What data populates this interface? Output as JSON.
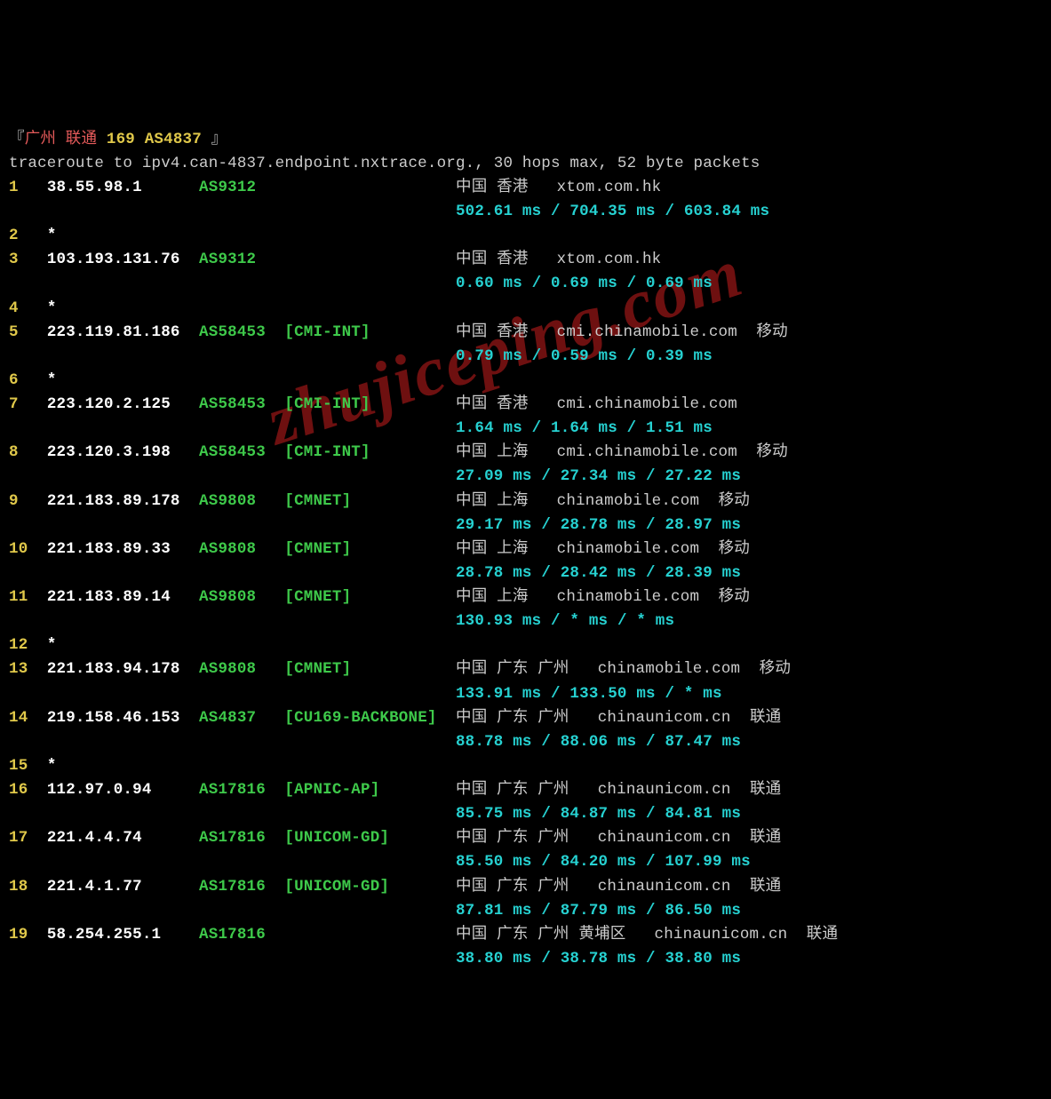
{
  "header": {
    "open": "『",
    "close": "』",
    "location": "广州 联通",
    "asn_text": "169 AS4837"
  },
  "command": "traceroute to ipv4.can-4837.endpoint.nxtrace.org., 30 hops max, 52 byte packets",
  "watermark": "zhujiceping.com",
  "columns": {
    "hop_w": 4,
    "ip_w": 16,
    "asn_w": 9,
    "tag_w": 18,
    "rtt_indent": 47
  },
  "hops": [
    {
      "n": "1",
      "ip": "38.55.98.1",
      "asn": "AS9312",
      "tag": "",
      "loc": "中国 香港",
      "dom": "xtom.com.hk",
      "isp": "",
      "rtt": [
        "502.61 ms",
        "704.35 ms",
        "603.84 ms"
      ]
    },
    {
      "n": "2",
      "ip": "*"
    },
    {
      "n": "3",
      "ip": "103.193.131.76",
      "asn": "AS9312",
      "tag": "",
      "loc": "中国 香港",
      "dom": "xtom.com.hk",
      "isp": "",
      "rtt": [
        "0.60 ms",
        "0.69 ms",
        "0.69 ms"
      ]
    },
    {
      "n": "4",
      "ip": "*"
    },
    {
      "n": "5",
      "ip": "223.119.81.186",
      "asn": "AS58453",
      "tag": "[CMI-INT]",
      "loc": "中国 香港",
      "dom": "cmi.chinamobile.com",
      "isp": "移动",
      "rtt": [
        "0.79 ms",
        "0.59 ms",
        "0.39 ms"
      ]
    },
    {
      "n": "6",
      "ip": "*"
    },
    {
      "n": "7",
      "ip": "223.120.2.125",
      "asn": "AS58453",
      "tag": "[CMI-INT]",
      "loc": "中国 香港",
      "dom": "cmi.chinamobile.com",
      "isp": "",
      "rtt": [
        "1.64 ms",
        "1.64 ms",
        "1.51 ms"
      ]
    },
    {
      "n": "8",
      "ip": "223.120.3.198",
      "asn": "AS58453",
      "tag": "[CMI-INT]",
      "loc": "中国 上海",
      "dom": "cmi.chinamobile.com",
      "isp": "移动",
      "rtt": [
        "27.09 ms",
        "27.34 ms",
        "27.22 ms"
      ]
    },
    {
      "n": "9",
      "ip": "221.183.89.178",
      "asn": "AS9808",
      "tag": "[CMNET]",
      "loc": "中国 上海",
      "dom": "chinamobile.com",
      "isp": "移动",
      "rtt": [
        "29.17 ms",
        "28.78 ms",
        "28.97 ms"
      ]
    },
    {
      "n": "10",
      "ip": "221.183.89.33",
      "asn": "AS9808",
      "tag": "[CMNET]",
      "loc": "中国 上海",
      "dom": "chinamobile.com",
      "isp": "移动",
      "rtt": [
        "28.78 ms",
        "28.42 ms",
        "28.39 ms"
      ]
    },
    {
      "n": "11",
      "ip": "221.183.89.14",
      "asn": "AS9808",
      "tag": "[CMNET]",
      "loc": "中国 上海",
      "dom": "chinamobile.com",
      "isp": "移动",
      "rtt": [
        "130.93 ms",
        "* ms",
        "* ms"
      ]
    },
    {
      "n": "12",
      "ip": "*"
    },
    {
      "n": "13",
      "ip": "221.183.94.178",
      "asn": "AS9808",
      "tag": "[CMNET]",
      "loc": "中国 广东 广州",
      "dom": "chinamobile.com",
      "isp": "移动",
      "rtt": [
        "133.91 ms",
        "133.50 ms",
        "* ms"
      ]
    },
    {
      "n": "14",
      "ip": "219.158.46.153",
      "asn": "AS4837",
      "tag": "[CU169-BACKBONE]",
      "loc": "中国 广东 广州",
      "dom": "chinaunicom.cn",
      "isp": "联通",
      "rtt": [
        "88.78 ms",
        "88.06 ms",
        "87.47 ms"
      ]
    },
    {
      "n": "15",
      "ip": "*"
    },
    {
      "n": "16",
      "ip": "112.97.0.94",
      "asn": "AS17816",
      "tag": "[APNIC-AP]",
      "loc": "中国 广东 广州",
      "dom": "chinaunicom.cn",
      "isp": "联通",
      "rtt": [
        "85.75 ms",
        "84.87 ms",
        "84.81 ms"
      ]
    },
    {
      "n": "17",
      "ip": "221.4.4.74",
      "asn": "AS17816",
      "tag": "[UNICOM-GD]",
      "loc": "中国 广东 广州",
      "dom": "chinaunicom.cn",
      "isp": "联通",
      "rtt": [
        "85.50 ms",
        "84.20 ms",
        "107.99 ms"
      ]
    },
    {
      "n": "18",
      "ip": "221.4.1.77",
      "asn": "AS17816",
      "tag": "[UNICOM-GD]",
      "loc": "中国 广东 广州",
      "dom": "chinaunicom.cn",
      "isp": "联通",
      "rtt": [
        "87.81 ms",
        "87.79 ms",
        "86.50 ms"
      ]
    },
    {
      "n": "19",
      "ip": "58.254.255.1",
      "asn": "AS17816",
      "tag": "",
      "loc": "中国 广东 广州 黄埔区",
      "dom": "chinaunicom.cn",
      "isp": "联通",
      "rtt": [
        "38.80 ms",
        "38.78 ms",
        "38.80 ms"
      ]
    }
  ]
}
